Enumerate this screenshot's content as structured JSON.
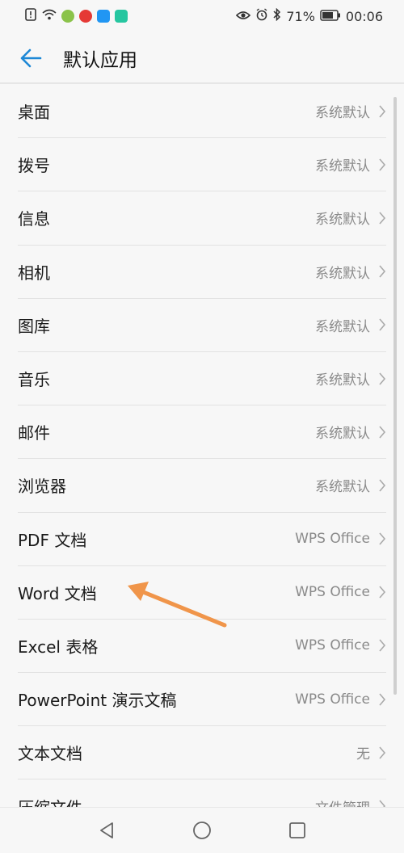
{
  "status": {
    "battery": "71%",
    "time": "00:06"
  },
  "header": {
    "title": "默认应用"
  },
  "items": [
    {
      "label": "桌面",
      "value": "系统默认"
    },
    {
      "label": "拨号",
      "value": "系统默认"
    },
    {
      "label": "信息",
      "value": "系统默认"
    },
    {
      "label": "相机",
      "value": "系统默认"
    },
    {
      "label": "图库",
      "value": "系统默认"
    },
    {
      "label": "音乐",
      "value": "系统默认"
    },
    {
      "label": "邮件",
      "value": "系统默认"
    },
    {
      "label": "浏览器",
      "value": "系统默认"
    },
    {
      "label": "PDF 文档",
      "value": "WPS Office"
    },
    {
      "label": "Word 文档",
      "value": "WPS Office"
    },
    {
      "label": "Excel 表格",
      "value": "WPS Office"
    },
    {
      "label": "PowerPoint 演示文稿",
      "value": "WPS Office"
    },
    {
      "label": "文本文档",
      "value": "无"
    },
    {
      "label": "压缩文件",
      "value": "文件管理"
    }
  ],
  "colors": {
    "accent": "#1e88d6",
    "annotation_arrow": "#f0954a"
  }
}
